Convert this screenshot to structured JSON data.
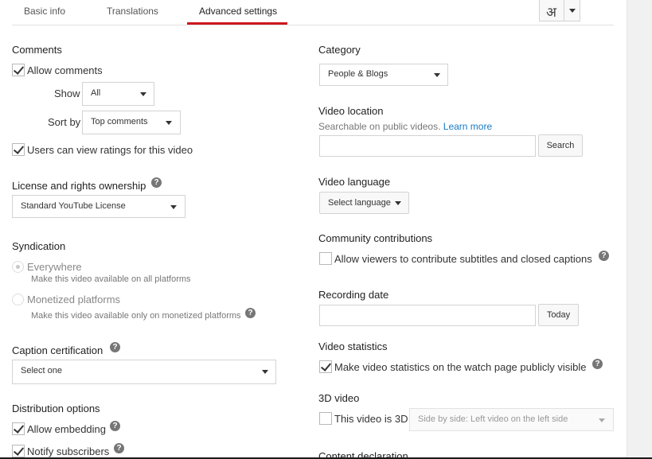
{
  "tabs": [
    {
      "label": "Basic info"
    },
    {
      "label": "Translations"
    },
    {
      "label": "Advanced settings",
      "active": true
    }
  ],
  "language_glyph": "अ",
  "comments": {
    "heading": "Comments",
    "allow_label": "Allow comments",
    "allow_checked": true,
    "show_label": "Show",
    "show_value": "All",
    "sortby_label": "Sort by",
    "sortby_value": "Top comments",
    "ratings_label": "Users can view ratings for this video",
    "ratings_checked": true
  },
  "license": {
    "heading": "License and rights ownership",
    "value": "Standard YouTube License"
  },
  "syndication": {
    "heading": "Syndication",
    "options": [
      {
        "label": "Everywhere",
        "desc": "Make this video available on all platforms",
        "selected": true
      },
      {
        "label": "Monetized platforms",
        "desc": "Make this video available only on monetized platforms",
        "selected": false
      }
    ]
  },
  "caption": {
    "heading": "Caption certification",
    "value": "Select one"
  },
  "distribution": {
    "heading": "Distribution options",
    "embed_label": "Allow embedding",
    "embed_checked": true,
    "notify_label": "Notify subscribers",
    "notify_checked": true
  },
  "category": {
    "heading": "Category",
    "value": "People & Blogs"
  },
  "location": {
    "heading": "Video location",
    "desc": "Searchable on public videos.",
    "link": "Learn more",
    "value": "",
    "search_button": "Search"
  },
  "language": {
    "heading": "Video language",
    "button": "Select language"
  },
  "community": {
    "heading": "Community contributions",
    "label": "Allow viewers to contribute subtitles and closed captions",
    "checked": false
  },
  "recording": {
    "heading": "Recording date",
    "value": "",
    "today_button": "Today"
  },
  "statistics": {
    "heading": "Video statistics",
    "label": "Make video statistics on the watch page publicly visible",
    "checked": true
  },
  "video3d": {
    "heading": "3D video",
    "label": "This video is 3D",
    "checked": false,
    "select_value": "Side by side: Left video on the left side"
  },
  "content_declaration": {
    "heading": "Content declaration"
  },
  "help_glyph": "?"
}
